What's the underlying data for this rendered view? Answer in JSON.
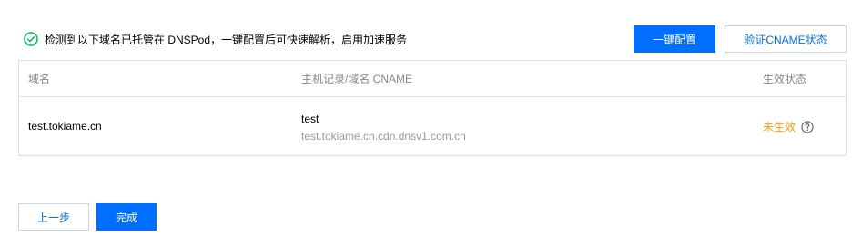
{
  "notice": {
    "icon": "check-circle-icon",
    "text": "检测到以下域名已托管在 DNSPod，一键配置后可快速解析，启用加速服务"
  },
  "actions": {
    "one_click_config": "一键配置",
    "verify_cname": "验证CNAME状态"
  },
  "table": {
    "columns": [
      "域名",
      "主机记录/域名 CNAME",
      "生效状态"
    ],
    "rows": [
      {
        "domain": "test.tokiame.cn",
        "host_record": "test",
        "cname": "test.tokiame.cn.cdn.dnsv1.com.cn",
        "status": "未生效",
        "status_icon": "help-circle-icon"
      }
    ]
  },
  "footer": {
    "prev": "上一步",
    "finish": "完成"
  },
  "colors": {
    "primary": "#006eff",
    "success": "#0abf5b",
    "warning": "#ff9c19",
    "muted": "#999999"
  }
}
